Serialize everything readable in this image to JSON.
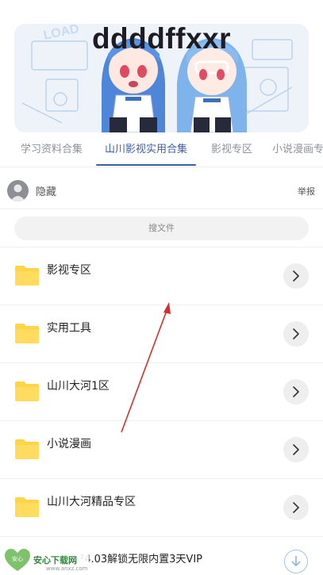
{
  "banner": {
    "title": "ddddffxxr",
    "art_text": "LOAD"
  },
  "tabs": [
    {
      "label": "学习资料合集"
    },
    {
      "label": "山川影视实用合集"
    },
    {
      "label": "影视专区"
    },
    {
      "label": "小说漫画专"
    }
  ],
  "active_tab": "山川影视实用合集",
  "owner": {
    "name": "隐藏",
    "report_label": "举报"
  },
  "search": {
    "placeholder": "搜文件"
  },
  "folders": [
    {
      "label": "影视专区"
    },
    {
      "label": "实用工具"
    },
    {
      "label": "山川大河1区"
    },
    {
      "label": "小说漫画"
    },
    {
      "label": "山川大河精品专区"
    }
  ],
  "promo": {
    "text": "²4.03解锁无限内置3天VIP"
  },
  "watermark": {
    "name": "安心下载网",
    "url": "www.anxz.com",
    "logo_text": "安心"
  },
  "colors": {
    "accent": "#3d5fa6",
    "folder": "#ffd447",
    "annotation_arrow": "#d22f2f"
  },
  "icons": {
    "folder": "folder-icon",
    "chevron": "chevron-right-icon",
    "download": "download-icon",
    "avatar": "user-icon"
  }
}
